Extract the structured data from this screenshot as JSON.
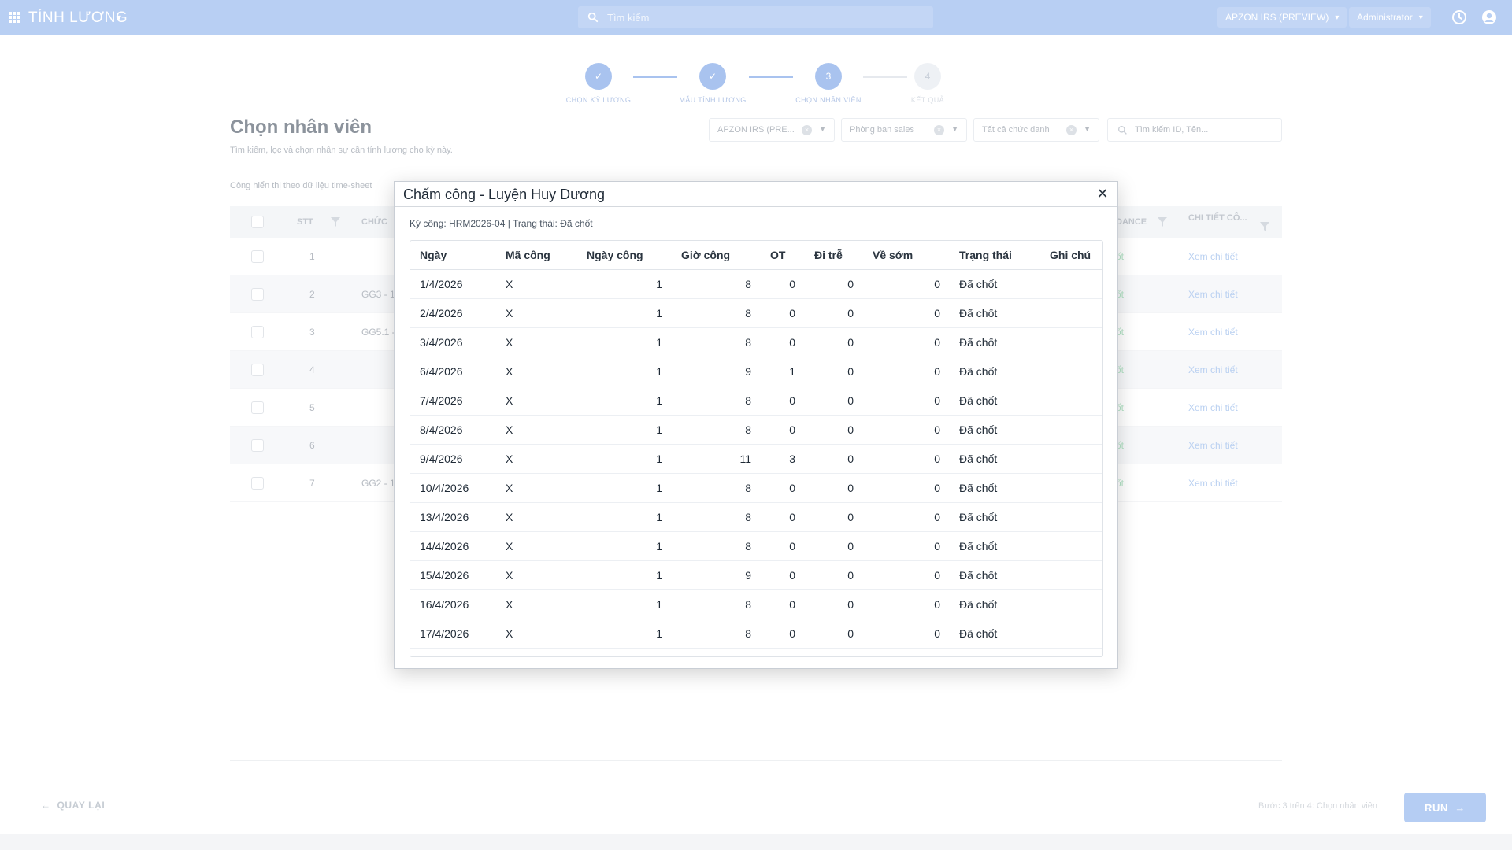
{
  "topbar": {
    "app_title": "TÍNH LƯƠNG",
    "search_placeholder": "Tìm kiếm",
    "company": "APZON IRS (PREVIEW)",
    "user": "Administrator"
  },
  "stepper": {
    "steps": [
      {
        "label": "CHỌN KỲ LƯƠNG",
        "marker": "✓"
      },
      {
        "label": "MẪU TÍNH LƯƠNG",
        "marker": "✓"
      },
      {
        "label": "CHỌN NHÂN VIÊN",
        "marker": "3"
      },
      {
        "label": "KẾT QUẢ",
        "marker": "4"
      }
    ]
  },
  "page": {
    "title": "Chọn nhân viên",
    "subtitle": "Tìm kiếm, lọc và chọn nhân sự cần tính lương cho kỳ này.",
    "note": "Công hiển thị theo dữ liệu time-sheet",
    "filters": {
      "company": "APZON IRS (PRE...",
      "department": "Phòng ban sales",
      "title": "Tất cả chức danh",
      "search_placeholder": "Tìm kiếm ID, Tên..."
    },
    "columns": {
      "stt": "STT",
      "position": "CHỨC",
      "attendance": "DANCE",
      "detail": "CHI TIẾT CÔ..."
    },
    "rows": [
      {
        "stt": "1",
        "position": "",
        "badge": "ốt",
        "link": "Xem chi tiết"
      },
      {
        "stt": "2",
        "position": "GG3 - 1",
        "badge": "ốt",
        "link": "Xem chi tiết"
      },
      {
        "stt": "3",
        "position": "GG5.1 -",
        "badge": "ốt",
        "link": "Xem chi tiết"
      },
      {
        "stt": "4",
        "position": "",
        "badge": "ốt",
        "link": "Xem chi tiết"
      },
      {
        "stt": "5",
        "position": "",
        "badge": "ốt",
        "link": "Xem chi tiết"
      },
      {
        "stt": "6",
        "position": "",
        "badge": "ốt",
        "link": "Xem chi tiết"
      },
      {
        "stt": "7",
        "position": "GG2 - 1",
        "badge": "ốt",
        "link": "Xem chi tiết"
      }
    ],
    "back_label": "QUAY LẠI",
    "footer_note": "Bước 3 trên 4: Chọn nhân viên",
    "run_label": "RUN"
  },
  "modal": {
    "title": "Chấm công - Luyện Huy Dương",
    "meta": "Kỳ công: HRM2026-04 | Trạng thái: Đã chốt",
    "columns": [
      "Ngày",
      "Mã công",
      "Ngày công",
      "Giờ công",
      "OT",
      "Đi trễ",
      "Về sớm",
      "Trạng thái",
      "Ghi chú"
    ],
    "rows": [
      {
        "date": "1/4/2026",
        "code": "X",
        "days": "1",
        "hours": "8",
        "ot": "0",
        "late": "0",
        "early": "0",
        "status": "Đã chốt",
        "note": ""
      },
      {
        "date": "2/4/2026",
        "code": "X",
        "days": "1",
        "hours": "8",
        "ot": "0",
        "late": "0",
        "early": "0",
        "status": "Đã chốt",
        "note": ""
      },
      {
        "date": "3/4/2026",
        "code": "X",
        "days": "1",
        "hours": "8",
        "ot": "0",
        "late": "0",
        "early": "0",
        "status": "Đã chốt",
        "note": ""
      },
      {
        "date": "6/4/2026",
        "code": "X",
        "days": "1",
        "hours": "9",
        "ot": "1",
        "late": "0",
        "early": "0",
        "status": "Đã chốt",
        "note": ""
      },
      {
        "date": "7/4/2026",
        "code": "X",
        "days": "1",
        "hours": "8",
        "ot": "0",
        "late": "0",
        "early": "0",
        "status": "Đã chốt",
        "note": ""
      },
      {
        "date": "8/4/2026",
        "code": "X",
        "days": "1",
        "hours": "8",
        "ot": "0",
        "late": "0",
        "early": "0",
        "status": "Đã chốt",
        "note": ""
      },
      {
        "date": "9/4/2026",
        "code": "X",
        "days": "1",
        "hours": "11",
        "ot": "3",
        "late": "0",
        "early": "0",
        "status": "Đã chốt",
        "note": ""
      },
      {
        "date": "10/4/2026",
        "code": "X",
        "days": "1",
        "hours": "8",
        "ot": "0",
        "late": "0",
        "early": "0",
        "status": "Đã chốt",
        "note": ""
      },
      {
        "date": "13/4/2026",
        "code": "X",
        "days": "1",
        "hours": "8",
        "ot": "0",
        "late": "0",
        "early": "0",
        "status": "Đã chốt",
        "note": ""
      },
      {
        "date": "14/4/2026",
        "code": "X",
        "days": "1",
        "hours": "8",
        "ot": "0",
        "late": "0",
        "early": "0",
        "status": "Đã chốt",
        "note": ""
      },
      {
        "date": "15/4/2026",
        "code": "X",
        "days": "1",
        "hours": "9",
        "ot": "0",
        "late": "0",
        "early": "0",
        "status": "Đã chốt",
        "note": ""
      },
      {
        "date": "16/4/2026",
        "code": "X",
        "days": "1",
        "hours": "8",
        "ot": "0",
        "late": "0",
        "early": "0",
        "status": "Đã chốt",
        "note": ""
      },
      {
        "date": "17/4/2026",
        "code": "X",
        "days": "1",
        "hours": "8",
        "ot": "0",
        "late": "0",
        "early": "0",
        "status": "Đã chốt",
        "note": ""
      }
    ]
  },
  "colors": {
    "topbar": "#b8cff3",
    "accent": "#a9c3ef",
    "modal_border": "#c9ced5"
  }
}
